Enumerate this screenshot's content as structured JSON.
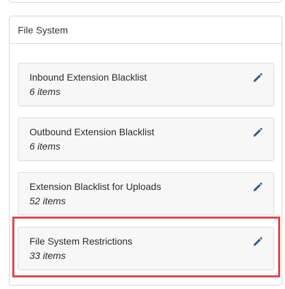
{
  "panel": {
    "title": "File System"
  },
  "cards": [
    {
      "title": "Inbound Extension Blacklist",
      "count": "6 items"
    },
    {
      "title": "Outbound Extension Blacklist",
      "count": "6 items"
    },
    {
      "title": "Extension Blacklist for Uploads",
      "count": "52 items"
    },
    {
      "title": "File System Restrictions",
      "count": "33 items"
    }
  ],
  "icons": {
    "edit": "pencil-icon"
  },
  "colors": {
    "highlight": "#e0454a",
    "edit_icon": "#2f5d8c",
    "card_background": "#f7f7f7"
  }
}
